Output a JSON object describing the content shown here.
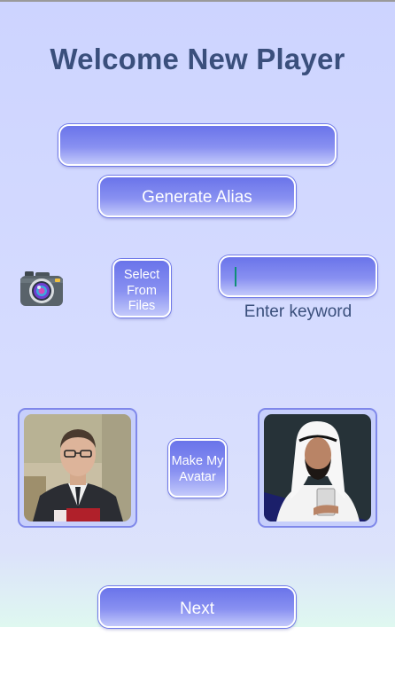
{
  "header": {
    "title": "Welcome New Player"
  },
  "alias": {
    "value": "",
    "generate_label": "Generate Alias"
  },
  "photo_source": {
    "camera_icon": "camera-icon",
    "select_files_label": "Select From Files",
    "keyword_value": "",
    "keyword_label": "Enter keyword"
  },
  "avatar": {
    "make_label": "Make My Avatar",
    "left_photo": "man-in-suit-photo",
    "right_photo": "man-in-white-headdress-photo"
  },
  "footer": {
    "next_label": "Next"
  },
  "colors": {
    "accent": "#6a74ea",
    "title": "#3a4f7c",
    "background": "#cdd4ff"
  }
}
